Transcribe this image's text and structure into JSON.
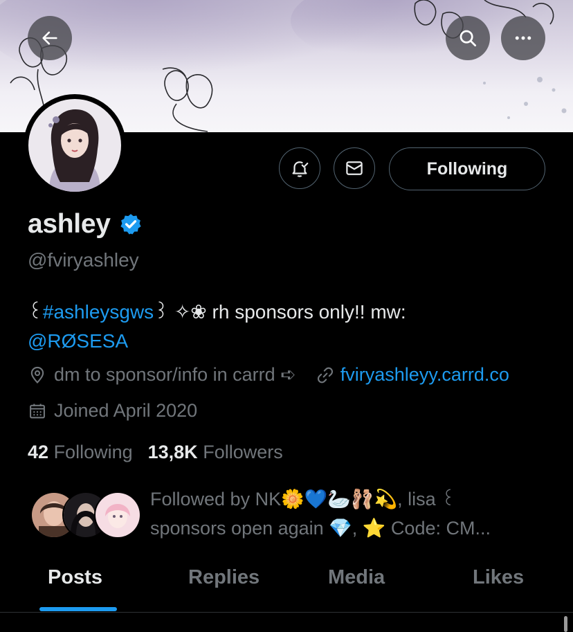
{
  "header": {
    "back_icon": "arrow-left-icon",
    "search_icon": "search-icon",
    "more_icon": "more-horizontal-icon"
  },
  "profile": {
    "display_name": "ashley",
    "verified": true,
    "handle": "@fviryashley",
    "bio_prefix": "꒰",
    "bio_hashtag": "#ashleysgws",
    "bio_middle": "꒱ ✧❀ rh sponsors only!! mw:",
    "bio_mention": "@RØSESA",
    "location": "dm to sponsor/info in carrd ➪",
    "website": "fviryashleyy.carrd.co",
    "joined": "Joined April 2020"
  },
  "actions": {
    "notify_icon": "bell-check-icon",
    "message_icon": "mail-icon",
    "following_label": "Following"
  },
  "stats": {
    "following_count": "42",
    "following_label": "Following",
    "followers_count": "13,8K",
    "followers_label": "Followers"
  },
  "followed_by": {
    "line1": "Followed by NK🌼💙🦢🩰💫, lisa ꒰",
    "line2": "sponsors open again 💎, ⭐ Code: CM..."
  },
  "tabs": [
    {
      "label": "Posts",
      "active": true
    },
    {
      "label": "Replies",
      "active": false
    },
    {
      "label": "Media",
      "active": false
    },
    {
      "label": "Likes",
      "active": false
    }
  ],
  "colors": {
    "accent": "#1d9bf0",
    "background": "#000000",
    "muted_text": "#71767b",
    "verified_badge": "#1d9bf0"
  }
}
